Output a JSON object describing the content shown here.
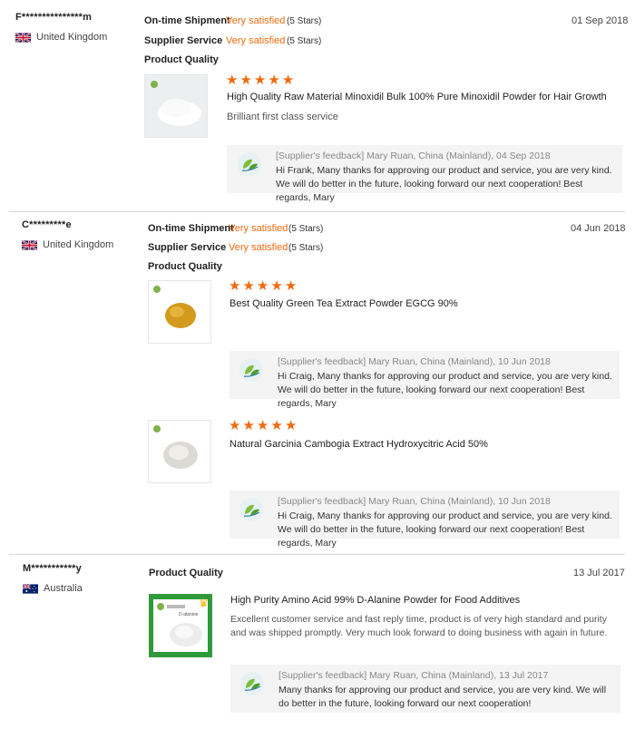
{
  "reviews": [
    {
      "name": "F***************m",
      "country": "United Kingdom",
      "date": "01 Sep 2018",
      "ratings": [
        {
          "label": "On-time Shipment",
          "value": "Very satisfied",
          "note": "(5 Stars)"
        },
        {
          "label": "Supplier Service",
          "value": "Very satisfied",
          "note": "(5 Stars)"
        }
      ],
      "quality_label": "Product Quality",
      "products": [
        {
          "stars": 5,
          "title": "High Quality Raw Material Minoxidil Bulk 100% Pure Minoxidil Powder for Hair Growth",
          "comment": "Brilliant first class service",
          "feedback_head": "[Supplier's feedback] Mary Ruan, China (Mainland), 04 Sep 2018",
          "feedback_body": "Hi Frank, Many thanks for approving our product and service, you are very kind. We will do better in the future, looking forward our next cooperation! Best regards, Mary"
        }
      ]
    },
    {
      "name": "C*********e",
      "country": "United Kingdom",
      "date": "04 Jun 2018",
      "ratings": [
        {
          "label": "On-time Shipment",
          "value": "Very satisfied",
          "note": "(5 Stars)"
        },
        {
          "label": "Supplier Service",
          "value": "Very satisfied",
          "note": "(5 Stars)"
        }
      ],
      "quality_label": "Product Quality",
      "products": [
        {
          "stars": 5,
          "title": "Best Quality Green Tea Extract Powder EGCG 90%",
          "feedback_head": "[Supplier's feedback] Mary Ruan, China (Mainland), 10 Jun 2018",
          "feedback_body": "Hi Craig, Many thanks for approving our product and service, you are very kind. We will do better in the future, looking forward our next cooperation! Best regards, Mary"
        },
        {
          "stars": 5,
          "title": "Natural Garcinia Cambogia Extract Hydroxycitric Acid 50%",
          "feedback_head": "[Supplier's feedback] Mary Ruan, China (Mainland), 10 Jun 2018",
          "feedback_body": "Hi Craig, Many thanks for approving our product and service, you are very kind. We will do better in the future, looking forward our next cooperation! Best regards, Mary"
        }
      ]
    },
    {
      "name": "M***********y",
      "country": "Australia",
      "date": "13 Jul 2017",
      "quality_label": "Product Quality",
      "products": [
        {
          "title": "High Purity Amino Acid 99% D-Alanine Powder for Food Additives",
          "comment": "Excellent customer service and fast reply time, product is of very high standard and purity and was shipped promptly. Very much look forward to doing business with again in future.",
          "thumb_caption": "D-alanine",
          "feedback_head": "[Supplier's feedback] Mary Ruan, China (Mainland), 13 Jul 2017",
          "feedback_body": "Many thanks for approving our product and service, you are very kind. We will do better in the future, looking forward our next cooperation!"
        }
      ]
    }
  ],
  "colors": {
    "accent": "#f06a0f",
    "feedback_bg": "#f4f4f4",
    "divider": "#d6d6d6"
  },
  "icons": {
    "flag_uk": "uk-flag-icon",
    "flag_au": "australia-flag-icon",
    "star": "star-icon",
    "supplier": "leaf-logo-icon"
  }
}
